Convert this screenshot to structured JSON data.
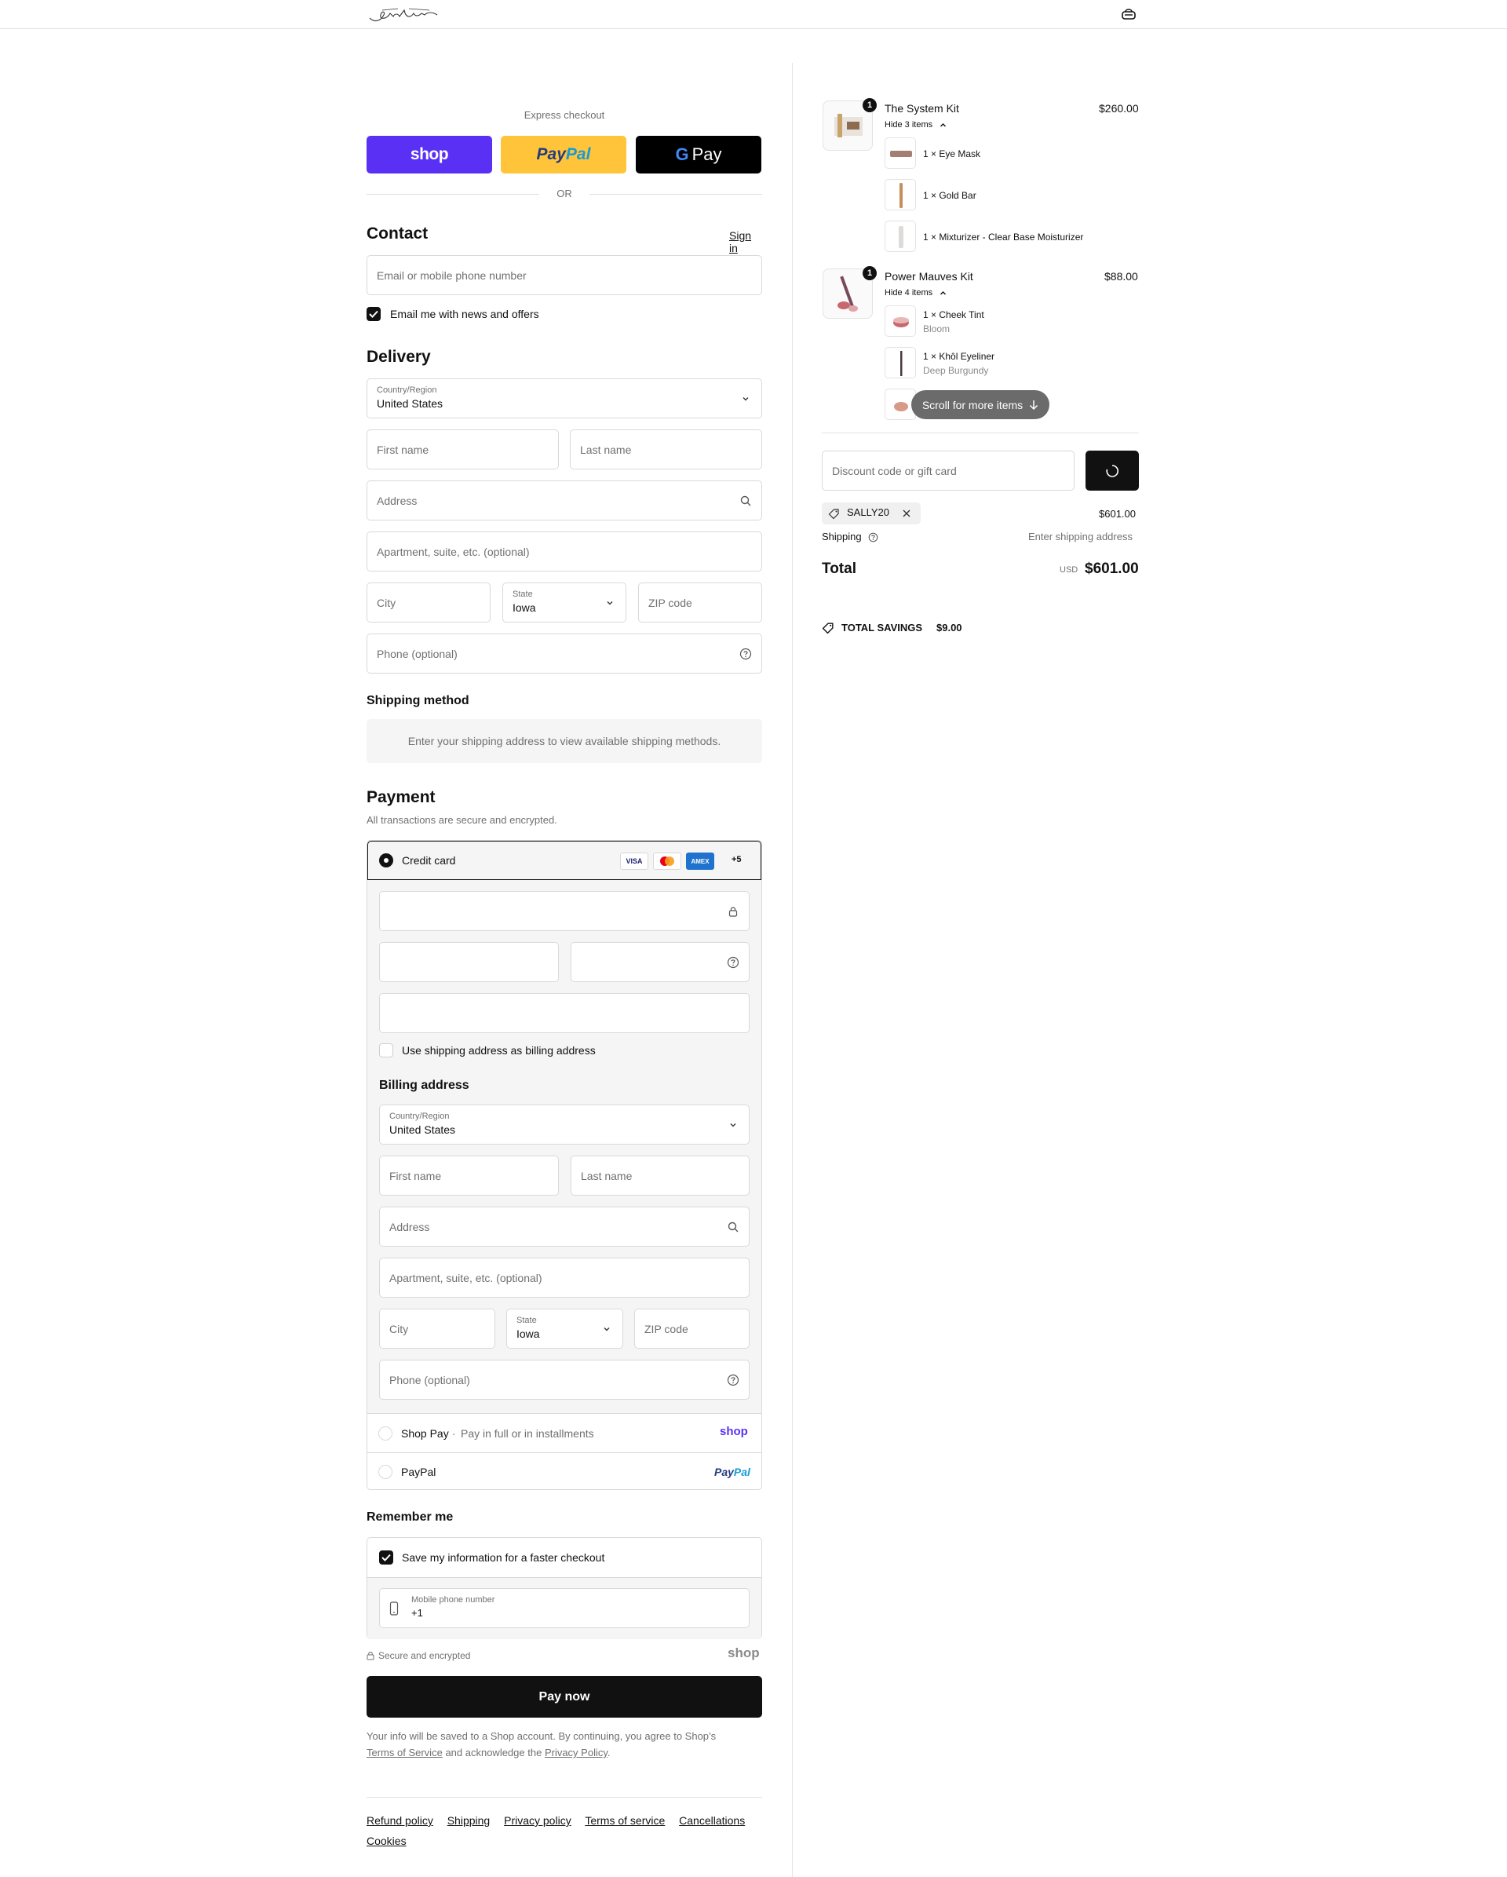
{
  "header": {
    "logo_alt": "Jones Road",
    "cart_icon": "bag-icon"
  },
  "express": {
    "label": "Express checkout",
    "shop_label": "shop",
    "paypal_a": "Pay",
    "paypal_b": "Pal",
    "gpay_g": "G",
    "gpay_label": "Pay",
    "or": "OR"
  },
  "contact": {
    "title": "Contact",
    "sign_in": "Sign in",
    "email_placeholder": "Email or mobile phone number",
    "newsletter_label": "Email me with news and offers",
    "newsletter_checked": true
  },
  "delivery": {
    "title": "Delivery",
    "country_label": "Country/Region",
    "country_value": "United States",
    "first_name": "First name",
    "last_name": "Last name",
    "address": "Address",
    "apartment": "Apartment, suite, etc. (optional)",
    "city": "City",
    "state_label": "State",
    "state_value": "Iowa",
    "zip": "ZIP code",
    "phone": "Phone (optional)"
  },
  "shipping_method": {
    "title": "Shipping method",
    "message": "Enter your shipping address to view available shipping methods."
  },
  "payment": {
    "title": "Payment",
    "subtitle": "All transactions are secure and encrypted.",
    "credit_card_label": "Credit card",
    "card_logos": [
      "VISA",
      "mastercard",
      "AMEX"
    ],
    "more_cards": "+5",
    "billing_same_label": "Use shipping address as billing address",
    "billing_title": "Billing address",
    "billing": {
      "country_label": "Country/Region",
      "country_value": "United States",
      "first_name": "First name",
      "last_name": "Last name",
      "address": "Address",
      "apartment": "Apartment, suite, etc. (optional)",
      "city": "City",
      "state_label": "State",
      "state_value": "Iowa",
      "zip": "ZIP code",
      "phone": "Phone (optional)"
    },
    "shop_pay_label": "Shop Pay",
    "shop_pay_dot": "·",
    "shop_pay_desc": "Pay in full or in installments",
    "shop_pay_logo": "shop",
    "paypal_label": "PayPal",
    "paypal_logo_a": "Pay",
    "paypal_logo_b": "Pal"
  },
  "remember": {
    "title": "Remember me",
    "save_label": "Save my information for a faster checkout",
    "save_checked": true,
    "mobile_label": "Mobile phone number",
    "mobile_value": "+1",
    "secure_label": "Secure and encrypted",
    "shop_logo": "shop"
  },
  "pay_now": "Pay now",
  "legal": {
    "text_1": "Your info will be saved to a Shop account. By continuing, you agree to Shop’s",
    "terms": "Terms of Service",
    "text_2": "and acknowledge the",
    "privacy": "Privacy Policy",
    "text_3": "."
  },
  "footer_links": [
    "Refund policy",
    "Shipping",
    "Privacy policy",
    "Terms of service",
    "Cancellations",
    "Cookies"
  ],
  "order": {
    "items": [
      {
        "name": "The System Kit",
        "qty": "1",
        "price": "$260.00",
        "toggle": "Hide 3 items",
        "subitems": [
          {
            "text": "1 × Eye Mask",
            "variant": ""
          },
          {
            "text": "1 × Gold Bar",
            "variant": ""
          },
          {
            "text": "1 × Mixturizer - Clear Base Moisturizer",
            "variant": ""
          }
        ]
      },
      {
        "name": "Power Mauves Kit",
        "qty": "1",
        "price": "$88.00",
        "toggle": "Hide 4 items",
        "subitems": [
          {
            "text": "1 × Cheek Tint",
            "variant": "Bloom"
          },
          {
            "text": "1 × Khôl Eyeliner",
            "variant": "Deep Burgundy"
          },
          {
            "text": "",
            "variant": ""
          }
        ]
      }
    ],
    "scroll_hint": "Scroll for more items",
    "discount_placeholder": "Discount code or gift card",
    "applied_code": "SALLY20",
    "subtotal_value": "$601.00",
    "shipping_label": "Shipping",
    "shipping_value": "Enter shipping address",
    "total_label": "Total",
    "currency": "USD",
    "total_value": "$601.00",
    "savings_label": "TOTAL SAVINGS",
    "savings_value": "$9.00"
  }
}
